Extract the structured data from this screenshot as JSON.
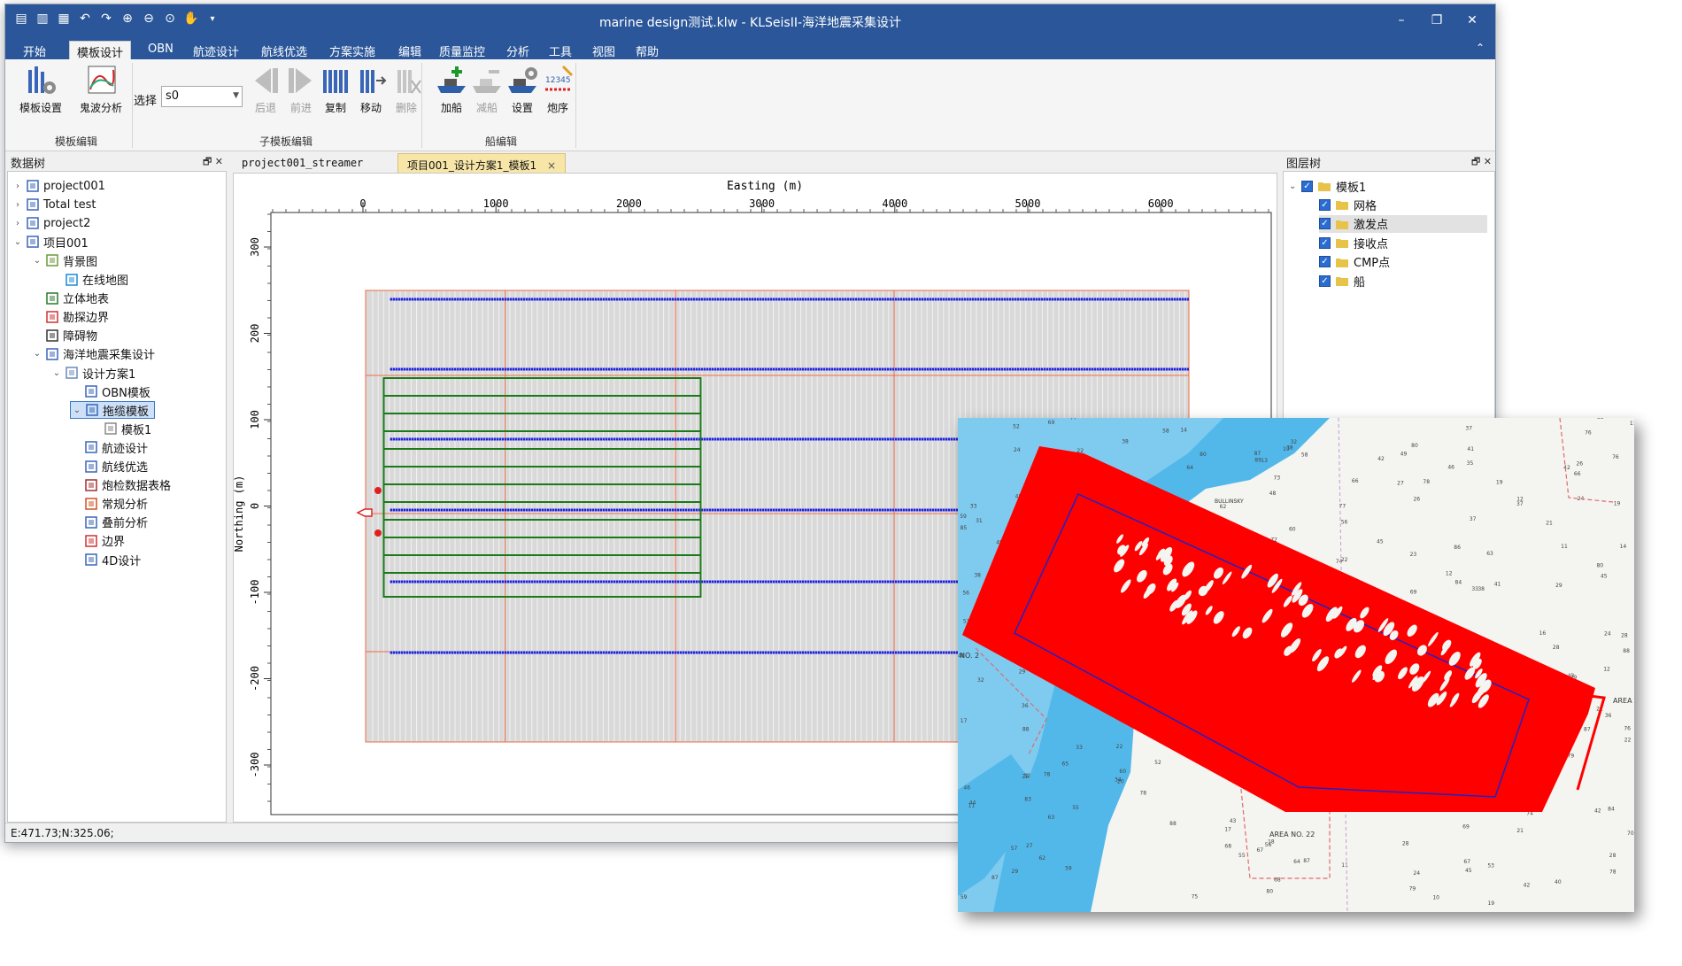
{
  "window": {
    "title": "marine design测试.klw - KLSeisII-海洋地震采集设计"
  },
  "menu": {
    "tabs": [
      "开始",
      "模板设计",
      "OBN",
      "航迹设计",
      "航线优选",
      "方案实施",
      "编辑",
      "质量监控",
      "分析",
      "工具",
      "视图",
      "帮助"
    ],
    "active_index": 1
  },
  "ribbon": {
    "template_edit": {
      "buttons": [
        "模板设置",
        "鬼波分析"
      ],
      "group_label": "模板编辑"
    },
    "sub_template_edit": {
      "select_label": "选择",
      "select_value": "s0",
      "buttons": [
        "后退",
        "前进",
        "复制",
        "移动",
        "删除"
      ],
      "group_label": "子模板编辑"
    },
    "ship_edit": {
      "buttons": [
        "加船",
        "减船",
        "设置",
        "炮序"
      ],
      "group_label": "船编辑"
    }
  },
  "data_tree": {
    "title": "数据树",
    "nodes": [
      {
        "label": "project001",
        "depth": 0,
        "expander": "right"
      },
      {
        "label": "Total test",
        "depth": 0,
        "expander": "right"
      },
      {
        "label": "project2",
        "depth": 0,
        "expander": "right"
      },
      {
        "label": "项目001",
        "depth": 0,
        "expander": "down"
      },
      {
        "label": "背景图",
        "depth": 1,
        "expander": "down"
      },
      {
        "label": "在线地图",
        "depth": 2,
        "expander": ""
      },
      {
        "label": "立体地表",
        "depth": 1,
        "expander": ""
      },
      {
        "label": "勘探边界",
        "depth": 1,
        "expander": ""
      },
      {
        "label": "障碍物",
        "depth": 1,
        "expander": ""
      },
      {
        "label": "海洋地震采集设计",
        "depth": 1,
        "expander": "down"
      },
      {
        "label": "设计方案1",
        "depth": 2,
        "expander": "down"
      },
      {
        "label": "OBN模板",
        "depth": 3,
        "expander": ""
      },
      {
        "label": "拖缆模板",
        "depth": 3,
        "expander": "down",
        "selected": true
      },
      {
        "label": "模板1",
        "depth": 4,
        "expander": ""
      },
      {
        "label": "航迹设计",
        "depth": 3,
        "expander": ""
      },
      {
        "label": "航线优选",
        "depth": 3,
        "expander": ""
      },
      {
        "label": "炮检数据表格",
        "depth": 3,
        "expander": ""
      },
      {
        "label": "常规分析",
        "depth": 3,
        "expander": ""
      },
      {
        "label": "叠前分析",
        "depth": 3,
        "expander": ""
      },
      {
        "label": "边界",
        "depth": 3,
        "expander": ""
      },
      {
        "label": "4D设计",
        "depth": 3,
        "expander": ""
      }
    ]
  },
  "document_tabs": [
    {
      "label": "project001_streamer",
      "active": false
    },
    {
      "label": "项目001_设计方案1_模板1",
      "active": true,
      "close": "×"
    }
  ],
  "plot": {
    "x_axis_label": "Easting (m)",
    "y_axis_label": "Northing (m)",
    "x_ticks": [
      "0",
      "1000",
      "2000",
      "3000",
      "4000",
      "5000",
      "6000"
    ],
    "y_ticks": [
      "300",
      "200",
      "100",
      "0",
      "-100",
      "-200",
      "-300"
    ]
  },
  "layer_tree": {
    "title": "图层树",
    "root": "模板1",
    "layers": [
      "网格",
      "激发点",
      "接收点",
      "CMP点",
      "船"
    ],
    "highlighted_index": 1
  },
  "status": {
    "coords": "E:471.73;N:325.06;"
  },
  "map": {
    "labels": [
      "AREA NO. 22",
      "NO. 2",
      "AREA",
      "BULLINSKY"
    ],
    "survey_color": "#ff0000",
    "boundary_color": "#1a24c8",
    "water_color": "#52b8ea",
    "land_color": "#f4f4f0"
  },
  "colors": {
    "titlebar": "#2b579a",
    "streamer_line": "#1f23d6",
    "source_line": "#1a7a1a",
    "grid_line": "#ee6b4d"
  }
}
